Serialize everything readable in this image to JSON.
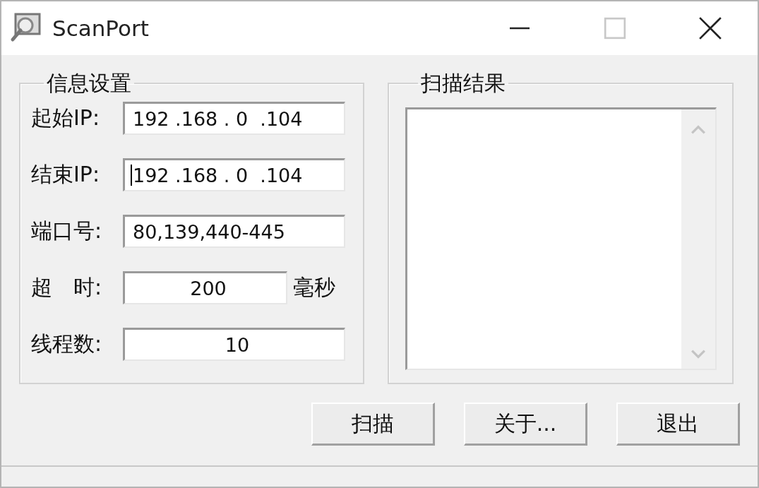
{
  "window": {
    "title": "ScanPort",
    "controls": [
      {
        "kind": "minimize",
        "disabled": false
      },
      {
        "kind": "maximize",
        "disabled": true
      },
      {
        "kind": "close",
        "disabled": false
      }
    ]
  },
  "settings": {
    "title": "信息设置",
    "fields": [
      {
        "label": "起始IP:",
        "value": "192 .168 . 0  .104",
        "kind": "ip",
        "focused": false
      },
      {
        "label": "结束IP:",
        "value": "192 .168 . 0  .104",
        "kind": "ip",
        "focused": true
      },
      {
        "label": "端口号:",
        "value": "80,139,440-445",
        "kind": "text",
        "focused": false
      },
      {
        "label": "超　时:",
        "value": "200",
        "kind": "number",
        "focused": false,
        "unit": "毫秒"
      },
      {
        "label": "线程数:",
        "value": "10",
        "kind": "number",
        "focused": false
      }
    ]
  },
  "results": {
    "title": "扫描结果"
  },
  "buttons": [
    "扫描",
    "关于...",
    "退出"
  ]
}
